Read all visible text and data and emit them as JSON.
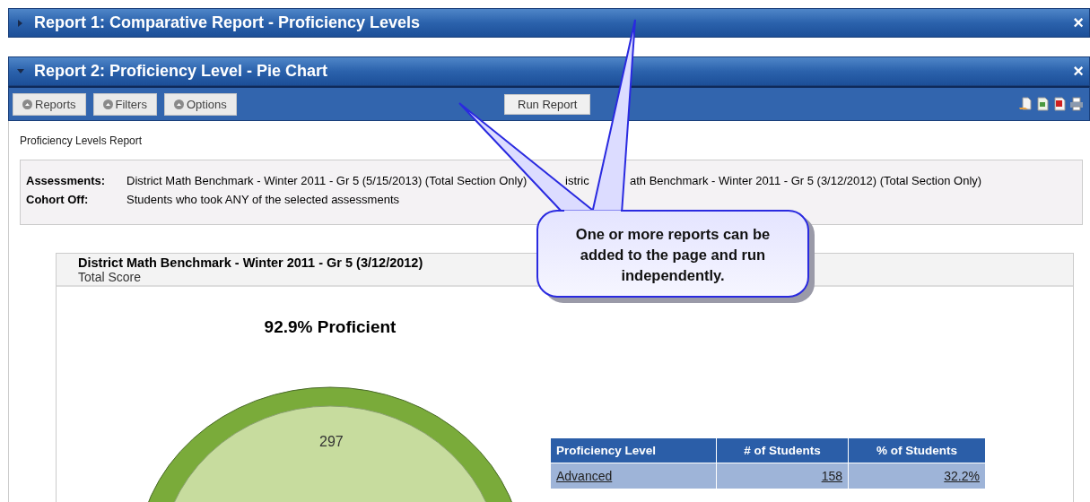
{
  "panels": [
    {
      "title": "Report 1: Comparative Report - Proficiency Levels",
      "expanded": false,
      "close": "×"
    },
    {
      "title": "Report 2: Proficiency Level - Pie Chart",
      "expanded": true,
      "close": "×"
    }
  ],
  "toolbar": {
    "buttons": [
      {
        "label": "Reports"
      },
      {
        "label": "Filters"
      },
      {
        "label": "Options"
      }
    ],
    "run_button": "Run Report"
  },
  "report_title": "Proficiency Levels Report",
  "criteria": [
    {
      "label": "Assessments:",
      "parts": [
        "District Math Benchmark - Winter 2011 - Gr 5 (5/15/2013) (Total Section Only)",
        "istric",
        "ath Benchmark - Winter 2011 - Gr 5 (3/12/2012) (Total Section Only)"
      ]
    },
    {
      "label": "Cohort Off:",
      "parts": [
        "Students who took ANY of the selected assessments"
      ]
    }
  ],
  "card": {
    "title": "District Math Benchmark - Winter 2011 - Gr 5 (3/12/2012)",
    "subtitle": "Total Score",
    "chart_title": "92.9% Proficient",
    "pie_label": "297"
  },
  "table": {
    "columns": [
      "Proficiency Level",
      "# of Students",
      "% of Students"
    ],
    "rows": [
      [
        "Advanced",
        "158",
        "32.2%"
      ]
    ]
  },
  "callout": "One or more reports can be added to the page and run independently."
}
